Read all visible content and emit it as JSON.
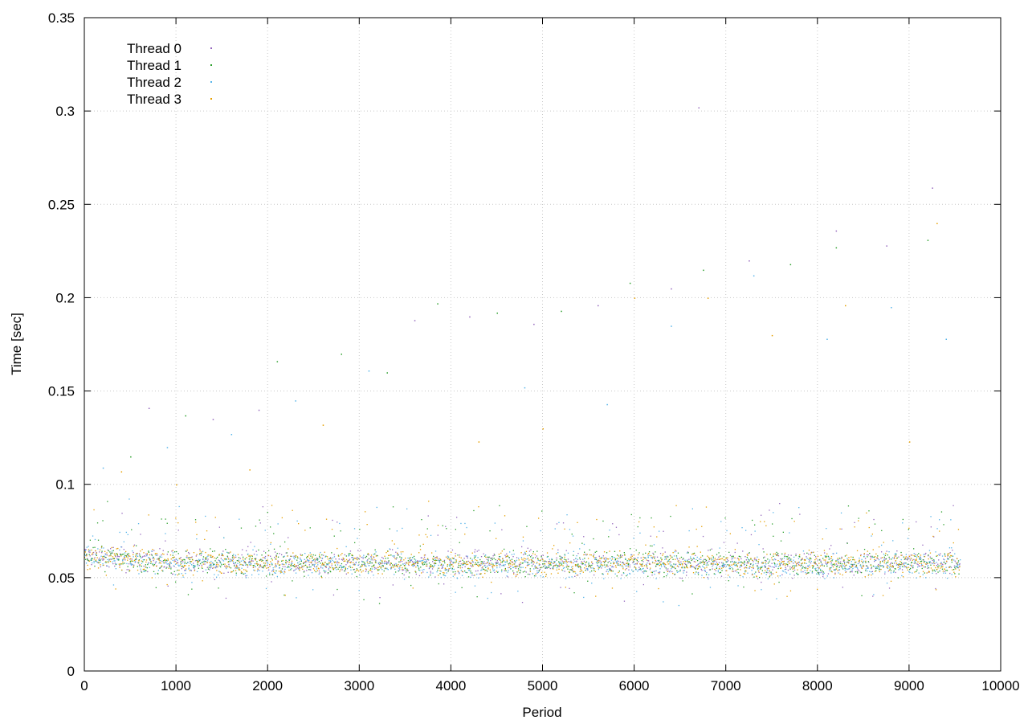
{
  "chart_data": {
    "type": "scatter",
    "title": "",
    "xlabel": "Period",
    "ylabel": "Time [sec]",
    "xlim": [
      0,
      10000
    ],
    "ylim": [
      0,
      0.35
    ],
    "x_ticks": [
      0,
      1000,
      2000,
      3000,
      4000,
      5000,
      6000,
      7000,
      8000,
      9000,
      10000
    ],
    "y_ticks": [
      0,
      0.05,
      0.1,
      0.15,
      0.2,
      0.25,
      0.3,
      0.35
    ],
    "x_tick_labels": [
      "0",
      "1000",
      "2000",
      "3000",
      "4000",
      "5000",
      "6000",
      "7000",
      "8000",
      "9000",
      "10000"
    ],
    "y_tick_labels": [
      "0",
      "0.05",
      "0.1",
      "0.15",
      "0.2",
      "0.25",
      "0.3",
      "0.35"
    ],
    "grid": true,
    "legend_position": "top-left",
    "x_max_data": 9550,
    "series": [
      {
        "name": "Thread 0",
        "color": "#9467bd",
        "typical_value": 0.058,
        "outliers": [
          [
            700,
            0.141
          ],
          [
            1400,
            0.135
          ],
          [
            1900,
            0.14
          ],
          [
            3600,
            0.188
          ],
          [
            4200,
            0.19
          ],
          [
            4900,
            0.186
          ],
          [
            5600,
            0.196
          ],
          [
            6400,
            0.205
          ],
          [
            6700,
            0.302
          ],
          [
            7250,
            0.22
          ],
          [
            8200,
            0.236
          ],
          [
            8750,
            0.228
          ],
          [
            9250,
            0.259
          ]
        ]
      },
      {
        "name": "Thread 1",
        "color": "#2ca02c",
        "typical_value": 0.058,
        "outliers": [
          [
            500,
            0.115
          ],
          [
            1100,
            0.137
          ],
          [
            2100,
            0.166
          ],
          [
            2800,
            0.17
          ],
          [
            3300,
            0.16
          ],
          [
            3850,
            0.197
          ],
          [
            4500,
            0.192
          ],
          [
            5200,
            0.193
          ],
          [
            5950,
            0.208
          ],
          [
            6750,
            0.215
          ],
          [
            7700,
            0.218
          ],
          [
            8200,
            0.227
          ],
          [
            9200,
            0.231
          ]
        ]
      },
      {
        "name": "Thread 2",
        "color": "#56b4e9",
        "typical_value": 0.057,
        "outliers": [
          [
            200,
            0.109
          ],
          [
            900,
            0.12
          ],
          [
            1600,
            0.127
          ],
          [
            2300,
            0.145
          ],
          [
            3100,
            0.161
          ],
          [
            4800,
            0.152
          ],
          [
            5700,
            0.143
          ],
          [
            6400,
            0.185
          ],
          [
            7300,
            0.212
          ],
          [
            8100,
            0.178
          ],
          [
            8800,
            0.195
          ],
          [
            9400,
            0.178
          ]
        ]
      },
      {
        "name": "Thread 3",
        "color": "#e69f00",
        "typical_value": 0.058,
        "outliers": [
          [
            400,
            0.107
          ],
          [
            1000,
            0.1
          ],
          [
            1800,
            0.108
          ],
          [
            2600,
            0.132
          ],
          [
            4300,
            0.123
          ],
          [
            5000,
            0.13
          ],
          [
            6000,
            0.2
          ],
          [
            6800,
            0.2
          ],
          [
            7500,
            0.18
          ],
          [
            8300,
            0.196
          ],
          [
            9000,
            0.123
          ],
          [
            9300,
            0.24
          ]
        ]
      }
    ]
  }
}
